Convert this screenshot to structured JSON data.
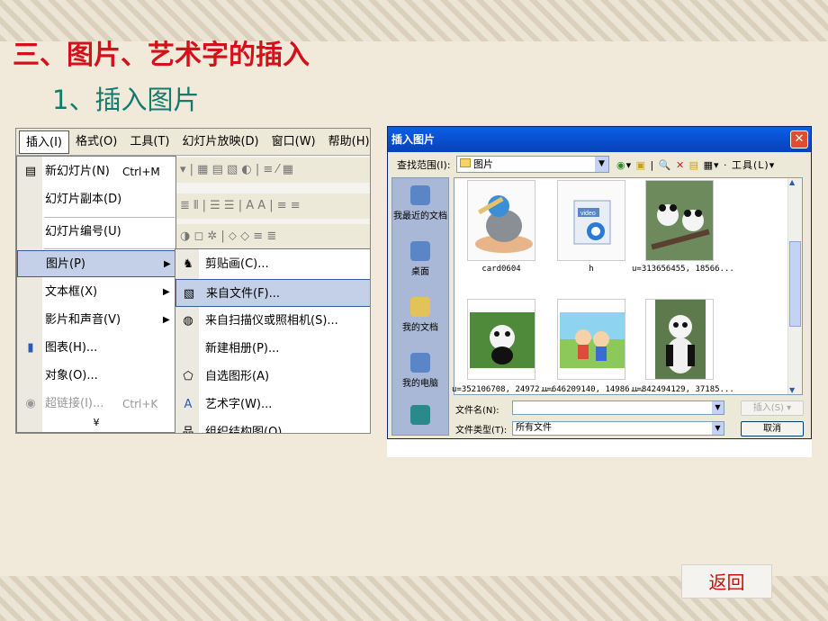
{
  "heading": "三、图片、艺术字的插入",
  "subheading": "1、插入图片",
  "menubar": [
    "插入(I)",
    "格式(O)",
    "工具(T)",
    "幻灯片放映(D)",
    "窗口(W)",
    "帮助(H)"
  ],
  "insert_menu": [
    {
      "label": "新幻灯片(N)",
      "shortcut": "Ctrl+M"
    },
    {
      "label": "幻灯片副本(D)"
    },
    {
      "label": "幻灯片编号(U)"
    },
    {
      "label": "图片(P)"
    },
    {
      "label": "文本框(X)"
    },
    {
      "label": "影片和声音(V)"
    },
    {
      "label": "图表(H)..."
    },
    {
      "label": "对象(O)..."
    },
    {
      "label": "超链接(I)...",
      "shortcut": "Ctrl+K"
    },
    {
      "label": "¥"
    }
  ],
  "picture_submenu": [
    "剪贴画(C)...",
    "来自文件(F)...",
    "来自扫描仪或照相机(S)...",
    "新建相册(P)...",
    "自选图形(A)",
    "艺术字(W)...",
    "组织结构图(O)"
  ],
  "dialog": {
    "title": "插入图片",
    "look_in_label": "查找范围(I):",
    "look_in_value": "图片",
    "tools_label": "工具(L)",
    "places": [
      "我最近的文档",
      "桌面",
      "我的文档",
      "我的电脑"
    ],
    "files": [
      "card0604",
      "h",
      "u=313656455, 18566...",
      "u=352106708, 24972...",
      "u=646209140, 14986...",
      "u=842494129, 37185..."
    ],
    "file_name_label": "文件名(N):",
    "file_name_value": "",
    "file_type_label": "文件类型(T):",
    "file_type_value": "所有文件",
    "insert_button": "插入(S)",
    "cancel_button": "取消",
    "video_label": "video"
  },
  "back_button": "返回"
}
